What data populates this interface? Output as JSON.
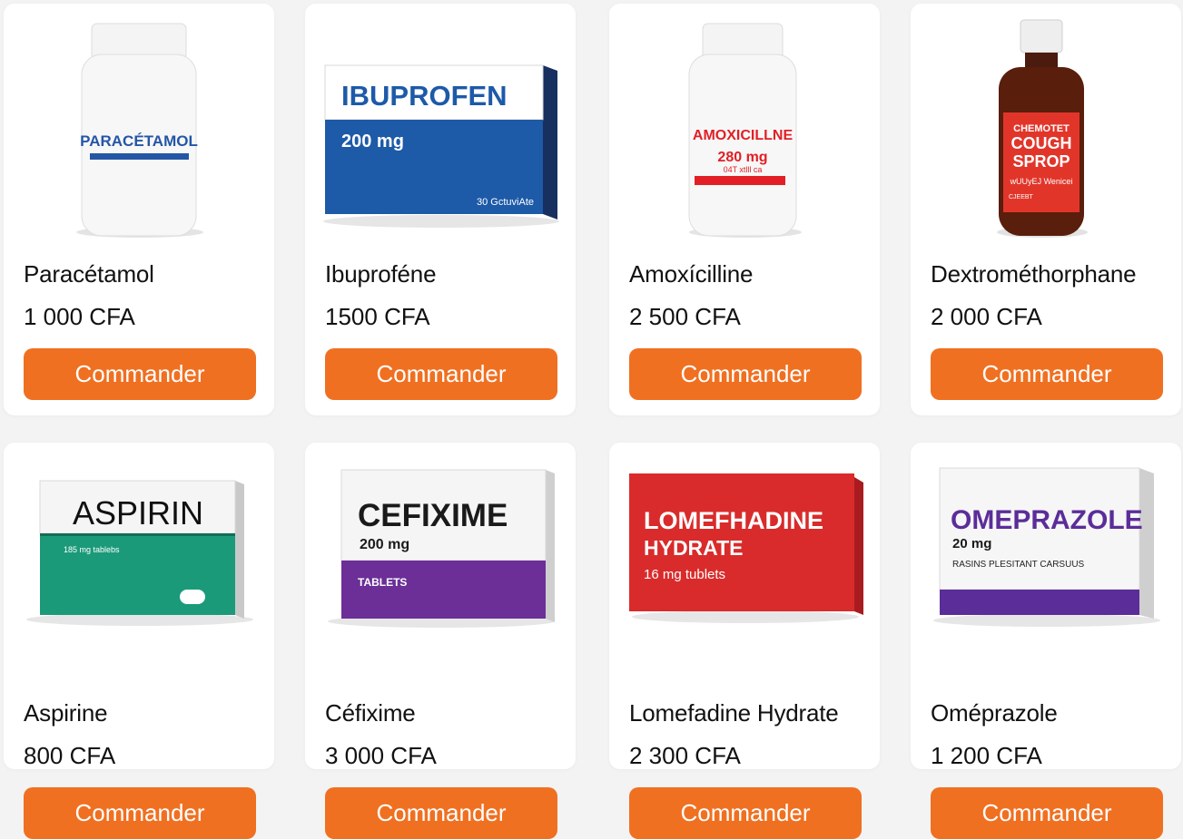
{
  "products": [
    {
      "name": "Paracétamol",
      "price": "1 000 CFA",
      "button": "Commander",
      "package": {
        "label": "PARACÉTAMOL"
      }
    },
    {
      "name": "Ibuproféne",
      "price": "1500 CFA",
      "button": "Commander",
      "package": {
        "title": "IBUPROFEN",
        "dose": "200 mg",
        "count": "30 GctuviAte"
      }
    },
    {
      "name": "Amoxícilline",
      "price": "2 500 CFA",
      "button": "Commander",
      "package": {
        "label": "AMOXICILLNE",
        "dose": "280 mg",
        "sub": "04T xtlll ca"
      }
    },
    {
      "name": "Dextrométhorphane",
      "price": "2 000 CFA",
      "button": "Commander",
      "package": {
        "line1": "CHEMOTET",
        "line2": "COUGH",
        "line3": "SPROP",
        "line4": "wUUyEJ Wenicei",
        "line5": "CJEEBT"
      }
    },
    {
      "name": "Aspirine",
      "price": "800 CFA",
      "button": "Commander",
      "package": {
        "title": "ASPIRIN",
        "sub": "185 mg tablebs"
      }
    },
    {
      "name": "Céfixime",
      "price": "3 000 CFA",
      "button": "Commander",
      "package": {
        "title": "CEFIXIME",
        "dose": "200 mg",
        "band": "TABLETS"
      }
    },
    {
      "name": "Lomefadine Hydrate",
      "price": "2 300 CFA",
      "button": "Commander",
      "package": {
        "line1": "LOMEFHADINE",
        "line2": "HYDRATE",
        "line3": "16 mg tublets"
      }
    },
    {
      "name": "Oméprazole",
      "price": "1 200 CFA",
      "button": "Commander",
      "package": {
        "title": "OMEPRAZOLE",
        "dose": "20 mg",
        "sub": "RASINS PLESITANT CARSUUS"
      }
    }
  ]
}
